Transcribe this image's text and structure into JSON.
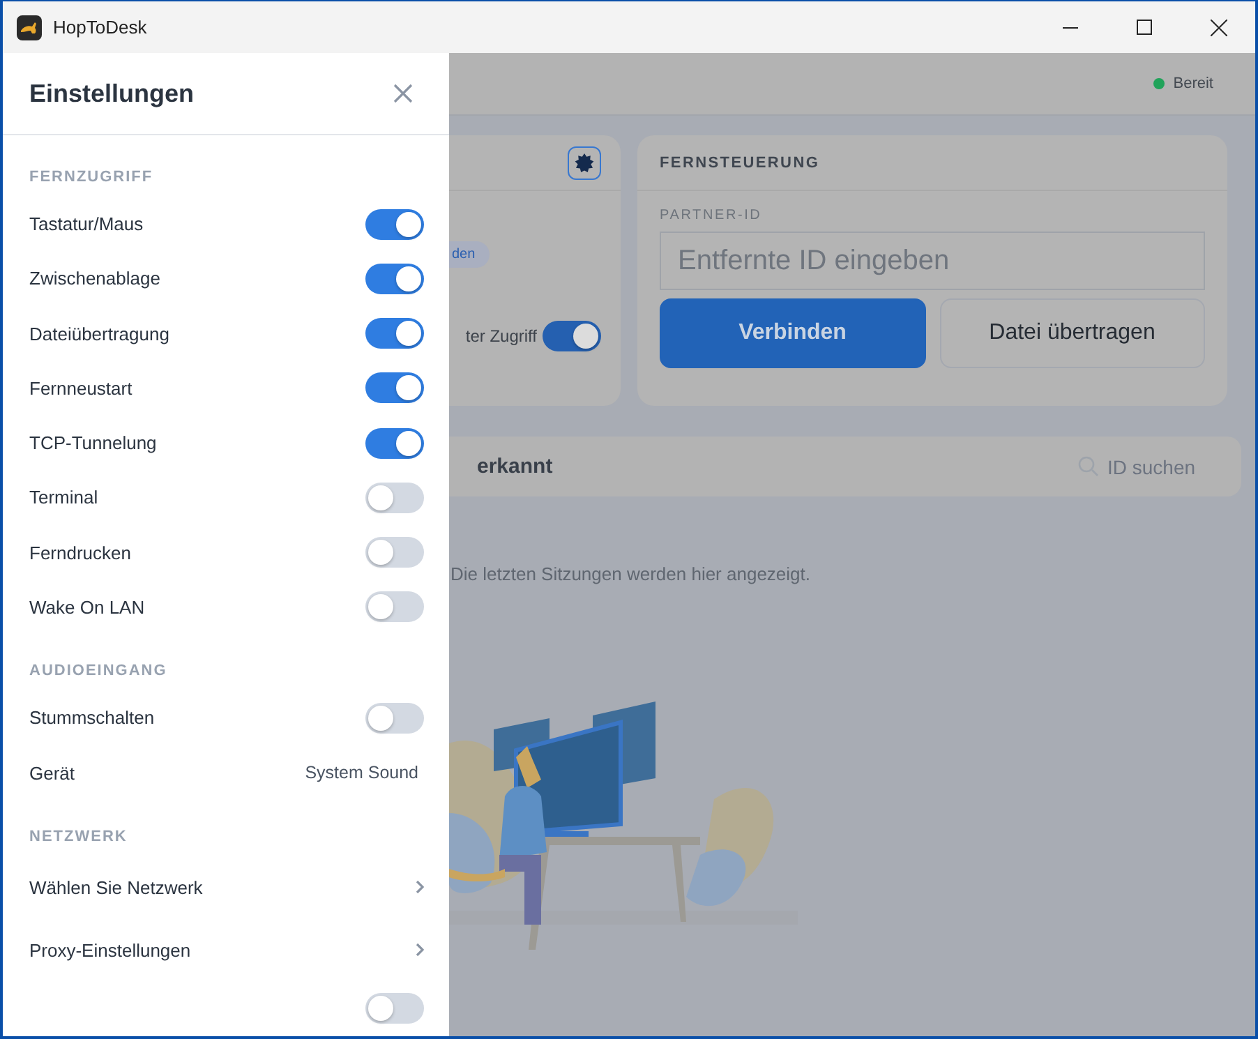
{
  "window": {
    "title": "HopToDesk"
  },
  "status": {
    "label": "Bereit",
    "color": "#21a35a"
  },
  "drawer": {
    "title": "Einstellungen",
    "sections": [
      {
        "heading": "FERNZUGRIFF",
        "items": [
          {
            "kind": "toggle",
            "label": "Tastatur/Maus",
            "on": true
          },
          {
            "kind": "toggle",
            "label": "Zwischenablage",
            "on": true
          },
          {
            "kind": "toggle",
            "label": "Dateiübertragung",
            "on": true
          },
          {
            "kind": "toggle",
            "label": "Fernneustart",
            "on": true
          },
          {
            "kind": "toggle",
            "label": "TCP-Tunnelung",
            "on": true
          },
          {
            "kind": "toggle",
            "label": "Terminal",
            "on": false
          },
          {
            "kind": "toggle",
            "label": "Ferndrucken",
            "on": false
          },
          {
            "kind": "toggle",
            "label": "Wake On LAN",
            "on": false
          }
        ]
      },
      {
        "heading": "AUDIOEINGANG",
        "items": [
          {
            "kind": "toggle",
            "label": "Stummschalten",
            "on": false
          },
          {
            "kind": "value",
            "label": "Gerät",
            "value": "System Sound"
          }
        ]
      },
      {
        "heading": "NETZWERK",
        "items": [
          {
            "kind": "link",
            "label": "Wählen Sie Netzwerk"
          },
          {
            "kind": "link",
            "label": "Proxy-Einstellungen"
          },
          {
            "kind": "toggle",
            "on": false
          }
        ]
      }
    ]
  },
  "access_card": {
    "chip": "den",
    "toggle_label": "ter Zugriff",
    "toggle_on": true
  },
  "remote": {
    "heading": "FERNSTEUERUNG",
    "field_label": "PARTNER-ID",
    "placeholder": "Entfernte ID eingeben",
    "buttons": [
      {
        "label": "Verbinden",
        "kind": "primary"
      },
      {
        "label": "Datei übertragen",
        "kind": "secondary"
      }
    ]
  },
  "sessions": {
    "title": "erkannt",
    "search_placeholder": "ID suchen",
    "empty_text": "Die letzten Sitzungen werden hier angezeigt."
  }
}
